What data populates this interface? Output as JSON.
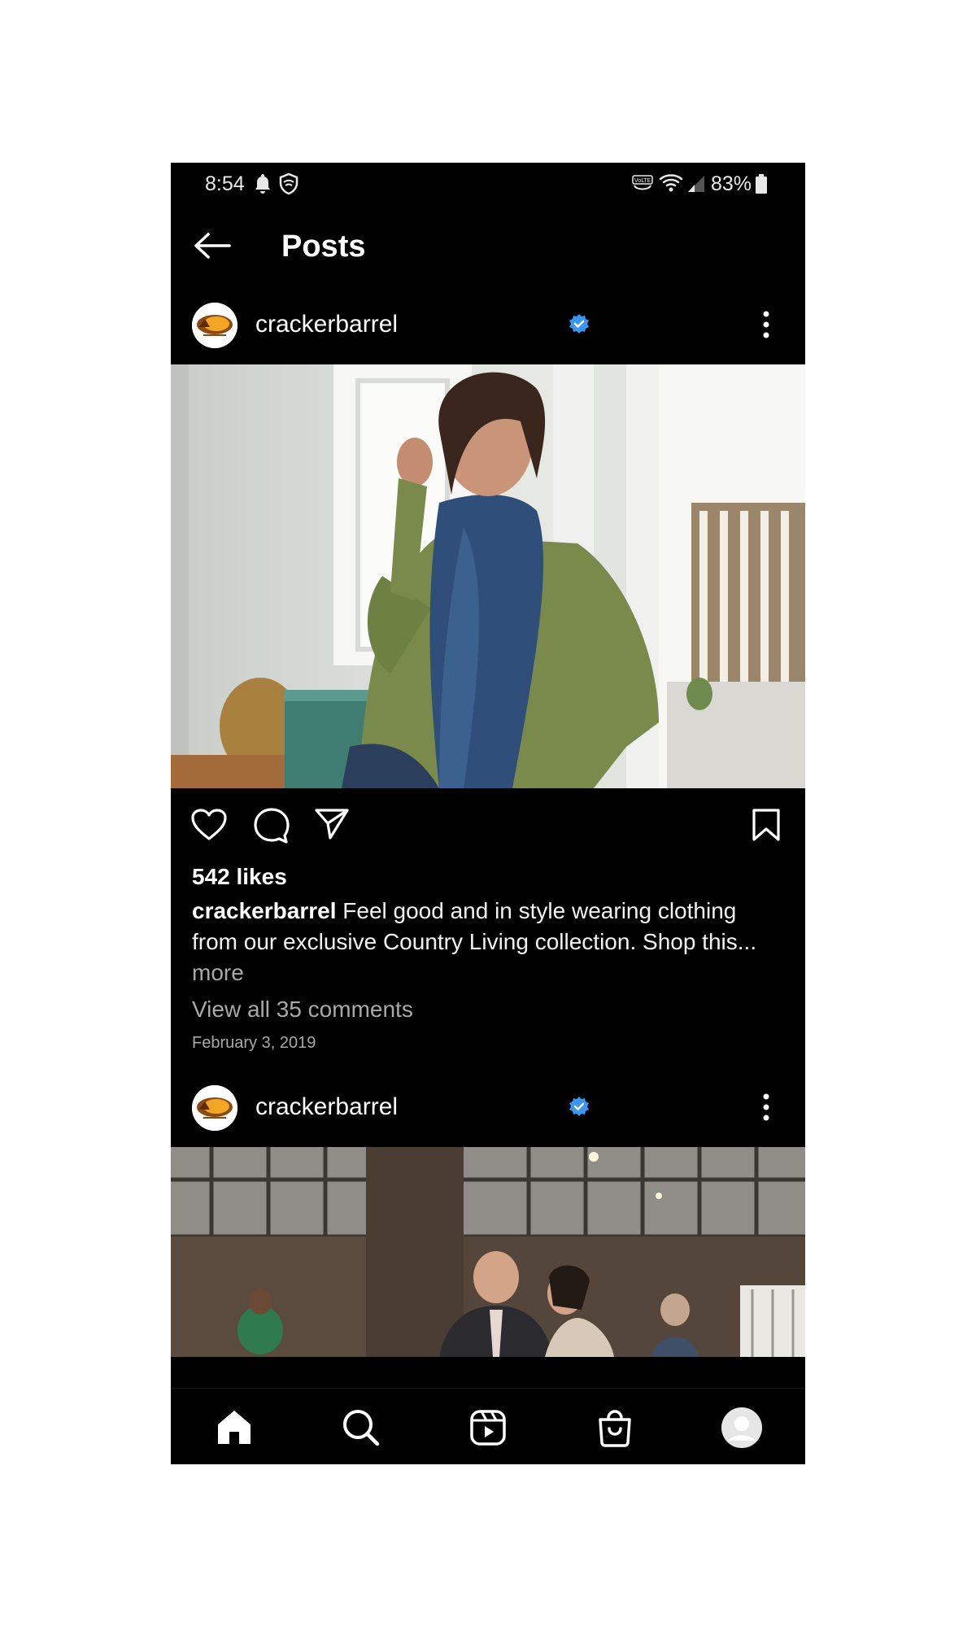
{
  "status_bar": {
    "time": "8:54",
    "battery": "83%",
    "icons": [
      "bell-icon",
      "shield-icon",
      "volte-icon",
      "wifi-icon",
      "signal-icon",
      "battery-icon"
    ]
  },
  "header": {
    "title": "Posts",
    "back_icon": "back-arrow-icon"
  },
  "posts": [
    {
      "username": "crackerbarrel",
      "verified": true,
      "likes": "542 likes",
      "caption_user": "crackerbarrel",
      "caption_text": " Feel good and in style wearing clothing from our exclusive Country Living collection. Shop this...",
      "caption_more": "more",
      "comments_link": "View all 35 comments",
      "date": "February 3, 2019"
    },
    {
      "username": "crackerbarrel",
      "verified": true
    }
  ],
  "actions": [
    "heart-icon",
    "comment-icon",
    "share-icon",
    "bookmark-icon"
  ],
  "bottom_nav": [
    "home-icon",
    "search-icon",
    "reels-icon",
    "shop-icon",
    "profile-avatar"
  ],
  "colors": {
    "background": "#000000",
    "text": "#ffffff",
    "muted": "#a8a8a8",
    "verified": "#3897f0"
  }
}
